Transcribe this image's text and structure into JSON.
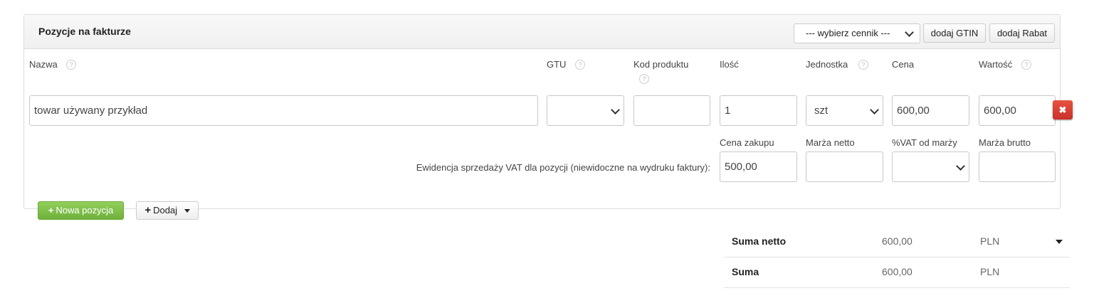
{
  "header": {
    "title": "Pozycje na fakturze",
    "price_list_select": "--- wybierz cennik ---",
    "add_gtin_label": "dodaj GTIN",
    "add_discount_label": "dodaj Rabat"
  },
  "columns": {
    "name": "Nazwa",
    "gtu": "GTU",
    "product_code": "Kod produktu",
    "quantity": "Ilość",
    "unit": "Jednostka",
    "price": "Cena",
    "value": "Wartość"
  },
  "help_glyph": "?",
  "item": {
    "name": "towar używany przykład",
    "gtu": "",
    "product_code": "",
    "quantity": "1",
    "unit": "szt",
    "price": "600,00",
    "value": "600,00"
  },
  "vat_section": {
    "description": "Ewidencja sprzedaży VAT dla pozycji (niewidoczne na wydruku faktury):",
    "purchase_price_label": "Cena zakupu",
    "purchase_price": "500,00",
    "net_margin_label": "Marża netto",
    "net_margin": "",
    "vat_margin_label": "%VAT od marży",
    "vat_margin": "",
    "gross_margin_label": "Marża brutto",
    "gross_margin": ""
  },
  "actions": {
    "new_item_label": "Nowa pozycja",
    "new_item_icon": "plus-icon",
    "add_label": "Dodaj",
    "add_icon": "plus-icon",
    "delete_icon": "close-icon",
    "delete_glyph": "✖"
  },
  "summary": {
    "rows": [
      {
        "label": "Suma netto",
        "value": "600,00",
        "currency": "PLN"
      },
      {
        "label": "Suma",
        "value": "600,00",
        "currency": "PLN"
      }
    ]
  },
  "colors": {
    "success_button": "#7cbf45",
    "danger_button": "#d9432f",
    "panel_header_bg": "#f3f3f3"
  }
}
